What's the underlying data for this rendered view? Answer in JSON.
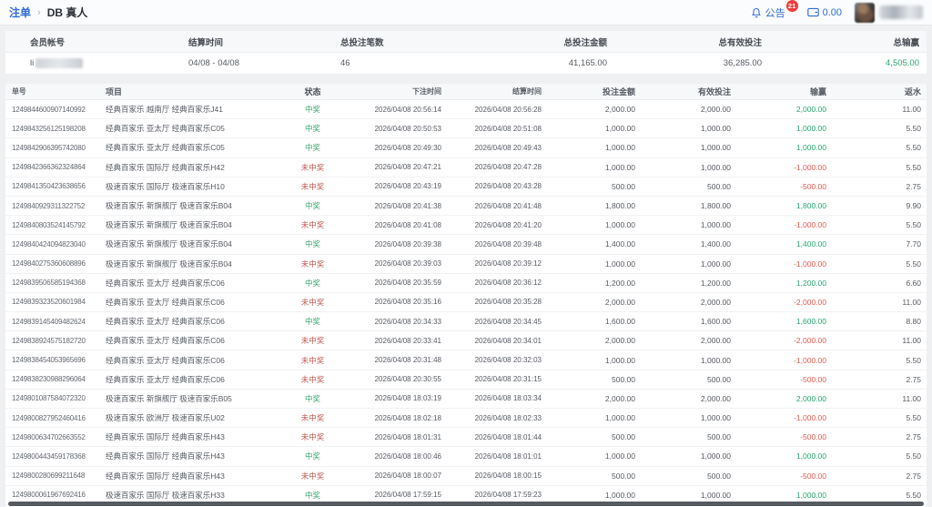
{
  "topbar": {
    "breadcrumb": {
      "root": "注单",
      "separator": "›",
      "current": "DB 真人"
    },
    "announcement": {
      "label": "公告",
      "badge": "21"
    },
    "wallet": {
      "balance": "0.00"
    }
  },
  "summary": {
    "columns": [
      "会员帐号",
      "结算时间",
      "总投注笔数",
      "总投注金额",
      "总有效投注",
      "总输赢"
    ],
    "account_prefix": "li",
    "settle_range": "04/08 - 04/08",
    "bet_count": "46",
    "total_bet": "41,165.00",
    "total_valid": "36,285.00",
    "total_winloss": "4,505.00"
  },
  "table": {
    "columns": [
      "单号",
      "项目",
      "状态",
      "下注时间",
      "结算时间",
      "投注金额",
      "有效投注",
      "输赢",
      "返水"
    ],
    "status_win_label": "中奖",
    "status_lose_label": "未中奖",
    "rows": [
      {
        "id": "1249844600907140992",
        "item": "经典百家乐 越南厅 经典百家乐J41",
        "status": "中奖",
        "win": true,
        "bet_time": "2026/04/08 20:56:14",
        "settle_time": "2026/04/08 20:56:28",
        "amount": "2,000.00",
        "valid": "2,000.00",
        "winloss": "2,000.00",
        "rebate": "11.00"
      },
      {
        "id": "1249843256125198208",
        "item": "经典百家乐 亚太厅 经典百家乐C05",
        "status": "中奖",
        "win": true,
        "bet_time": "2026/04/08 20:50:53",
        "settle_time": "2026/04/08 20:51:08",
        "amount": "1,000.00",
        "valid": "1,000.00",
        "winloss": "1,000.00",
        "rebate": "5.50"
      },
      {
        "id": "1249842906395742080",
        "item": "经典百家乐 亚太厅 经典百家乐C05",
        "status": "中奖",
        "win": true,
        "bet_time": "2026/04/08 20:49:30",
        "settle_time": "2026/04/08 20:49:43",
        "amount": "1,000.00",
        "valid": "1,000.00",
        "winloss": "1,000.00",
        "rebate": "5.50"
      },
      {
        "id": "1249842366362324864",
        "item": "经典百家乐 国际厅 经典百家乐H42",
        "status": "未中奖",
        "win": false,
        "bet_time": "2026/04/08 20:47:21",
        "settle_time": "2026/04/08 20:47:28",
        "amount": "1,000.00",
        "valid": "1,000.00",
        "winloss": "-1,000.00",
        "rebate": "5.50"
      },
      {
        "id": "1249841350423638656",
        "item": "极速百家乐 国际厅 极速百家乐H10",
        "status": "未中奖",
        "win": false,
        "bet_time": "2026/04/08 20:43:19",
        "settle_time": "2026/04/08 20:43:28",
        "amount": "500.00",
        "valid": "500.00",
        "winloss": "-500.00",
        "rebate": "2.75"
      },
      {
        "id": "1249840929311322752",
        "item": "极速百家乐 新旗舰厅 极速百家乐B04",
        "status": "中奖",
        "win": true,
        "bet_time": "2026/04/08 20:41:38",
        "settle_time": "2026/04/08 20:41:48",
        "amount": "1,800.00",
        "valid": "1,800.00",
        "winloss": "1,800.00",
        "rebate": "9.90"
      },
      {
        "id": "1249840803524145792",
        "item": "极速百家乐 新旗舰厅 极速百家乐B04",
        "status": "未中奖",
        "win": false,
        "bet_time": "2026/04/08 20:41:08",
        "settle_time": "2026/04/08 20:41:20",
        "amount": "1,000.00",
        "valid": "1,000.00",
        "winloss": "-1,000.00",
        "rebate": "5.50"
      },
      {
        "id": "1249840424094823040",
        "item": "极速百家乐 新旗舰厅 极速百家乐B04",
        "status": "中奖",
        "win": true,
        "bet_time": "2026/04/08 20:39:38",
        "settle_time": "2026/04/08 20:39:48",
        "amount": "1,400.00",
        "valid": "1,400.00",
        "winloss": "1,400.00",
        "rebate": "7.70"
      },
      {
        "id": "1249840275360608896",
        "item": "极速百家乐 新旗舰厅 极速百家乐B04",
        "status": "未中奖",
        "win": false,
        "bet_time": "2026/04/08 20:39:03",
        "settle_time": "2026/04/08 20:39:12",
        "amount": "1,000.00",
        "valid": "1,000.00",
        "winloss": "-1,000.00",
        "rebate": "5.50"
      },
      {
        "id": "1249839506585194368",
        "item": "经典百家乐 亚太厅 经典百家乐C06",
        "status": "中奖",
        "win": true,
        "bet_time": "2026/04/08 20:35:59",
        "settle_time": "2026/04/08 20:36:12",
        "amount": "1,200.00",
        "valid": "1,200.00",
        "winloss": "1,200.00",
        "rebate": "6.60"
      },
      {
        "id": "1249839323520601984",
        "item": "经典百家乐 亚太厅 经典百家乐C06",
        "status": "未中奖",
        "win": false,
        "bet_time": "2026/04/08 20:35:16",
        "settle_time": "2026/04/08 20:35:28",
        "amount": "2,000.00",
        "valid": "2,000.00",
        "winloss": "-2,000.00",
        "rebate": "11.00"
      },
      {
        "id": "1249839145409482624",
        "item": "经典百家乐 亚太厅 经典百家乐C06",
        "status": "中奖",
        "win": true,
        "bet_time": "2026/04/08 20:34:33",
        "settle_time": "2026/04/08 20:34:45",
        "amount": "1,600.00",
        "valid": "1,600.00",
        "winloss": "1,600.00",
        "rebate": "8.80"
      },
      {
        "id": "1249838924575182720",
        "item": "经典百家乐 亚太厅 经典百家乐C06",
        "status": "未中奖",
        "win": false,
        "bet_time": "2026/04/08 20:33:41",
        "settle_time": "2026/04/08 20:34:01",
        "amount": "2,000.00",
        "valid": "2,000.00",
        "winloss": "-2,000.00",
        "rebate": "11.00"
      },
      {
        "id": "1249838454053965696",
        "item": "经典百家乐 亚太厅 经典百家乐C06",
        "status": "未中奖",
        "win": false,
        "bet_time": "2026/04/08 20:31:48",
        "settle_time": "2026/04/08 20:32:03",
        "amount": "1,000.00",
        "valid": "1,000.00",
        "winloss": "-1,000.00",
        "rebate": "5.50"
      },
      {
        "id": "1249838230988296064",
        "item": "经典百家乐 亚太厅 经典百家乐C06",
        "status": "未中奖",
        "win": false,
        "bet_time": "2026/04/08 20:30:55",
        "settle_time": "2026/04/08 20:31:15",
        "amount": "500.00",
        "valid": "500.00",
        "winloss": "-500.00",
        "rebate": "2.75"
      },
      {
        "id": "1249801087584072320",
        "item": "极速百家乐 新旗舰厅 极速百家乐B05",
        "status": "中奖",
        "win": true,
        "bet_time": "2026/04/08 18:03:19",
        "settle_time": "2026/04/08 18:03:34",
        "amount": "2,000.00",
        "valid": "2,000.00",
        "winloss": "2,000.00",
        "rebate": "11.00"
      },
      {
        "id": "1249800827952460416",
        "item": "极速百家乐 欧洲厅 极速百家乐U02",
        "status": "未中奖",
        "win": false,
        "bet_time": "2026/04/08 18:02:18",
        "settle_time": "2026/04/08 18:02:33",
        "amount": "1,000.00",
        "valid": "1,000.00",
        "winloss": "-1,000.00",
        "rebate": "5.50"
      },
      {
        "id": "1249800634702663552",
        "item": "经典百家乐 国际厅 经典百家乐H43",
        "status": "未中奖",
        "win": false,
        "bet_time": "2026/04/08 18:01:31",
        "settle_time": "2026/04/08 18:01:44",
        "amount": "500.00",
        "valid": "500.00",
        "winloss": "-500.00",
        "rebate": "2.75"
      },
      {
        "id": "1249800443459178368",
        "item": "经典百家乐 国际厅 经典百家乐H43",
        "status": "中奖",
        "win": true,
        "bet_time": "2026/04/08 18:00:46",
        "settle_time": "2026/04/08 18:01:01",
        "amount": "1,000.00",
        "valid": "1,000.00",
        "winloss": "1,000.00",
        "rebate": "5.50"
      },
      {
        "id": "1249800280699211648",
        "item": "经典百家乐 国际厅 经典百家乐H43",
        "status": "未中奖",
        "win": false,
        "bet_time": "2026/04/08 18:00:07",
        "settle_time": "2026/04/08 18:00:15",
        "amount": "500.00",
        "valid": "500.00",
        "winloss": "-500.00",
        "rebate": "2.75"
      },
      {
        "id": "1249800061967692416",
        "item": "极速百家乐 国际厅 极速百家乐H33",
        "status": "中奖",
        "win": true,
        "bet_time": "2026/04/08 17:59:15",
        "settle_time": "2026/04/08 17:59:23",
        "amount": "1,000.00",
        "valid": "1,000.00",
        "winloss": "1,000.00",
        "rebate": "5.50"
      }
    ]
  },
  "colors": {
    "link_blue": "#2f6bd8",
    "win_green": "#27a76f",
    "lose_red": "#e05b52",
    "status_win": "#3da570",
    "status_lose": "#c05a52",
    "badge_red": "#f23c3c"
  }
}
